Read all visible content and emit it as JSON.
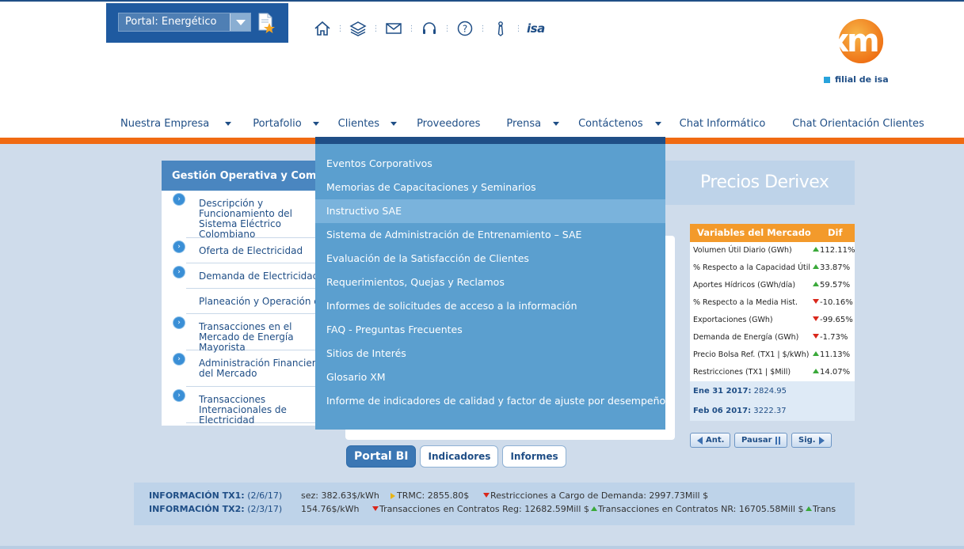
{
  "portal": {
    "selected": "Portal: Energético"
  },
  "utility_icons": [
    "home-icon",
    "layers-icon",
    "mail-icon",
    "headset-icon",
    "help-icon",
    "tie-icon"
  ],
  "isa_label": "isa",
  "brand": {
    "logo_text": "xm",
    "subtitle": "filial de isa"
  },
  "nav": {
    "items": [
      {
        "label": "Nuestra Empresa",
        "has_submenu": true
      },
      {
        "label": "Portafolio",
        "has_submenu": true
      },
      {
        "label": "Clientes",
        "has_submenu": true
      },
      {
        "label": "Proveedores",
        "has_submenu": false
      },
      {
        "label": "Prensa",
        "has_submenu": true
      },
      {
        "label": "Contáctenos",
        "has_submenu": true
      },
      {
        "label": "Chat Informático",
        "has_submenu": false
      },
      {
        "label": "Chat Orientación Clientes",
        "has_submenu": false
      }
    ]
  },
  "dropdown": {
    "items": [
      "Eventos Corporativos",
      "Memorias de Capacitaciones y Seminarios",
      "Instructivo SAE",
      "Sistema de Administración de Entrenamiento – SAE",
      "Evaluación de la Satisfacción de Clientes",
      "Requerimientos, Quejas y Reclamos",
      "Informes de solicitudes de acceso a la información",
      "FAQ - Preguntas Frecuentes",
      "Sitios de Interés",
      "Glosario XM",
      "Informe de indicadores de calidad y factor de ajuste por desempeño"
    ],
    "active_index": 2
  },
  "left_panel": {
    "title": "Gestión Operativa y Comercial",
    "items": [
      "Descripción y Funcionamiento del Sistema Eléctrico Colombiano",
      "Oferta de Electricidad",
      "Demanda de Electricidad",
      "Planeación y Operación del SIN",
      "Transacciones en el Mercado de Energía Mayorista",
      "Administración Financiera del Mercado",
      "Transacciones Internacionales de Electricidad"
    ]
  },
  "bi_buttons": {
    "portal_bi": "Portal BI",
    "indicadores": "Indicadores",
    "informes": "Informes"
  },
  "derivex": {
    "title": "Precios Derivex"
  },
  "market": {
    "title": "Variables del Mercado",
    "dif_label": "Dif",
    "rows": [
      {
        "label": "Volumen Útil Diario (GWh)",
        "value": "112.11%",
        "trend": "up"
      },
      {
        "label": "% Respecto a la Capacidad Útil",
        "value": "33.87%",
        "trend": "up"
      },
      {
        "label": "Aportes Hídricos (GWh/día)",
        "value": "59.57%",
        "trend": "up"
      },
      {
        "label": "% Respecto a la Media Hist.",
        "value": "-10.16%",
        "trend": "down"
      },
      {
        "label": "Exportaciones (GWh)",
        "value": "-99.65%",
        "trend": "down"
      },
      {
        "label": "Demanda de Energía  (GWh)",
        "value": "-1.73%",
        "trend": "down"
      },
      {
        "label": "Precio Bolsa Ref. (TX1 | $/kWh)",
        "value": "11.13%",
        "trend": "up"
      },
      {
        "label": "Restricciones (TX1 | $Mill)",
        "value": "14.07%",
        "trend": "up"
      }
    ],
    "date1_label": "Ene 31 2017:",
    "date1_value": "2824.95",
    "date2_label": "Feb 06 2017:",
    "date2_value": "3222.37",
    "btn_prev": "Ant.",
    "btn_pause": "Pausar",
    "btn_next": "Sig."
  },
  "ticker": {
    "tx1_label": "INFORMACIÓN TX1:",
    "tx1_date": "(2/6/17)",
    "tx1_a": "sez: 382.63$/kWh",
    "tx1_b": "TRMC: 2855.80$",
    "tx1_c": "Restricciones a Cargo de Demanda: 2997.73Mill $",
    "tx2_label": "INFORMACIÓN TX2:",
    "tx2_date": "(2/3/17)",
    "tx2_a": "154.76$/kWh",
    "tx2_b": "Transacciones en Contratos Reg: 12682.59Mill $",
    "tx2_c": "Transacciones en Contratos NR: 16705.58Mill $",
    "tx2_d": "Trans"
  },
  "colors": {
    "navy": "#1f4e86",
    "orange": "#f06a12",
    "dropdown": "#5b9fcf",
    "market_header": "#f39a2b"
  }
}
